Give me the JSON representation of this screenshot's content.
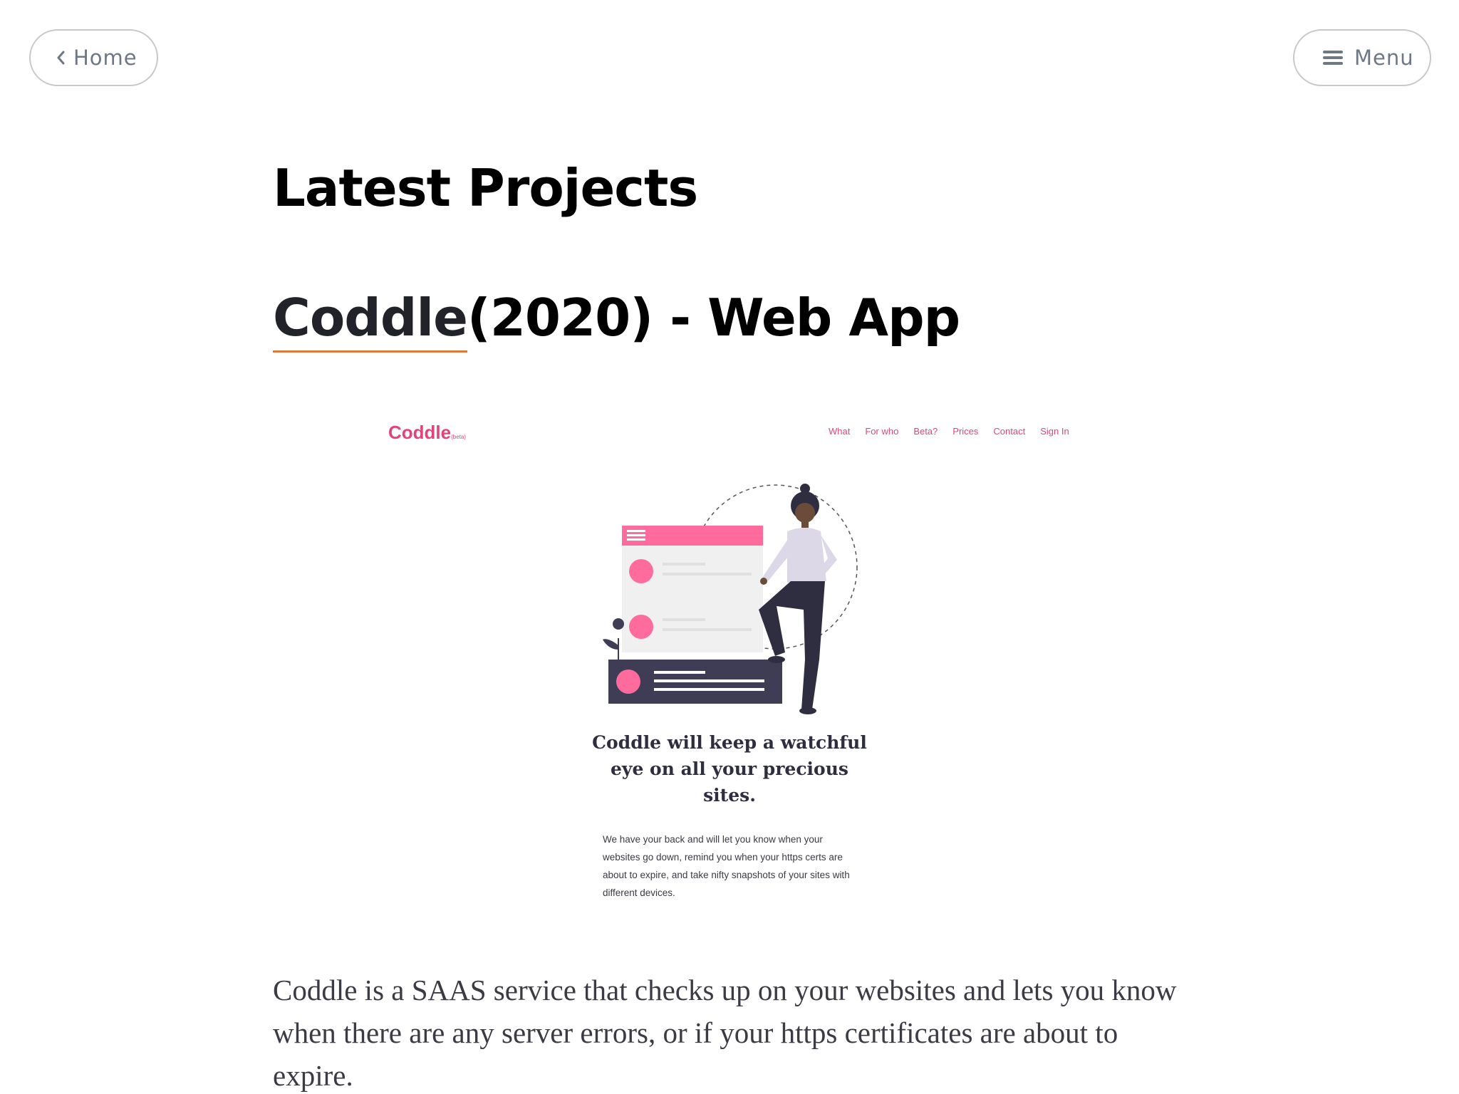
{
  "nav": {
    "home_label": "Home",
    "menu_label": "Menu"
  },
  "section": {
    "title": "Latest Projects"
  },
  "project": {
    "name": "Coddle",
    "title_suffix": "(2020) - Web App",
    "description": "Coddle is a SAAS service that checks up on your websites and lets you know when there are any server errors, or if your https certificates are about to expire."
  },
  "screenshot": {
    "logo": "Coddle",
    "logo_badge": "(beta)",
    "nav_items": [
      "What",
      "For who",
      "Beta?",
      "Prices",
      "Contact",
      "Sign In"
    ],
    "tagline": "Coddle will keep a watchful eye on all your precious sites.",
    "description": "We have your back and will let you know when your websites go down, remind you when your https certs are about to expire, and take nifty snapshots of your sites with different devices."
  },
  "colors": {
    "brand_pink": "#e2447a",
    "link_underline": "#e07a3a",
    "button_text": "#6d7785"
  }
}
